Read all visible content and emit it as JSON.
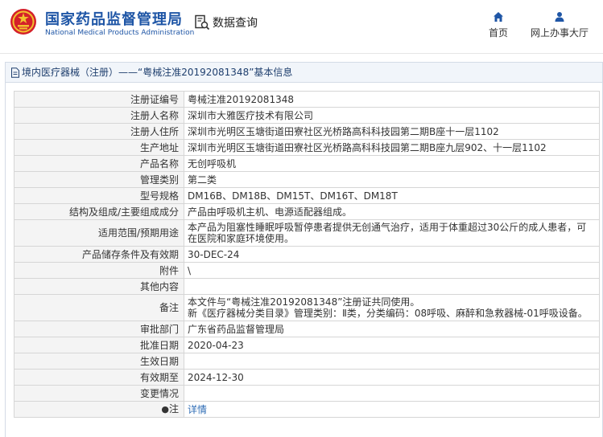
{
  "header": {
    "brand_cn": "国家药品监督管理局",
    "brand_en": "National Medical Products Administration",
    "query_label": "数据查询",
    "nav": [
      {
        "label": "首页",
        "icon": "home-icon"
      },
      {
        "label": "网上办事大厅",
        "icon": "user-icon"
      }
    ],
    "colors": {
      "brand": "#1f56a6",
      "emblem_red": "#d4202a",
      "emblem_gold": "#f2c12e"
    }
  },
  "panel": {
    "title": "境内医疗器械（注册）——“粤械注准20192081348”基本信息"
  },
  "rows": [
    {
      "key": "注册证编号",
      "value": "粤械注准20192081348"
    },
    {
      "key": "注册人名称",
      "value": "深圳市大雅医疗技术有限公司"
    },
    {
      "key": "注册人住所",
      "value": "深圳市光明区玉塘街道田寮社区光桥路高科科技园第二期B座十一层1102"
    },
    {
      "key": "生产地址",
      "value": "深圳市光明区玉塘街道田寮社区光桥路高科科技园第二期B座九层902、十一层1102"
    },
    {
      "key": "产品名称",
      "value": "无创呼吸机"
    },
    {
      "key": "管理类别",
      "value": "第二类"
    },
    {
      "key": "型号规格",
      "value": "DM16B、DM18B、DM15T、DM16T、DM18T"
    },
    {
      "key": "结构及组成/主要组成成分",
      "value": "产品由呼吸机主机、电源适配器组成。"
    },
    {
      "key": "适用范围/预期用途",
      "value": "本产品为阻塞性睡眠呼吸暂停患者提供无创通气治疗，适用于体重超过30公斤的成人患者，可在医院和家庭环境使用。"
    },
    {
      "key": "产品储存条件及有效期",
      "value": "30-DEC-24"
    },
    {
      "key": "附件",
      "value": "\\"
    },
    {
      "key": "其他内容",
      "value": ""
    },
    {
      "key": "备注",
      "value": "本文件与“粤械注准20192081348”注册证共同使用。\n新《医疗器械分类目录》管理类别：Ⅱ类，分类编码：08呼吸、麻醉和急救器械-01呼吸设备。"
    },
    {
      "key": "审批部门",
      "value": "广东省药品监督管理局"
    },
    {
      "key": "批准日期",
      "value": "2020-04-23"
    },
    {
      "key": "生效日期",
      "value": ""
    },
    {
      "key": "有效期至",
      "value": "2024-12-30"
    },
    {
      "key": "变更情况",
      "value": ""
    },
    {
      "key": "注",
      "value": "详情"
    }
  ]
}
